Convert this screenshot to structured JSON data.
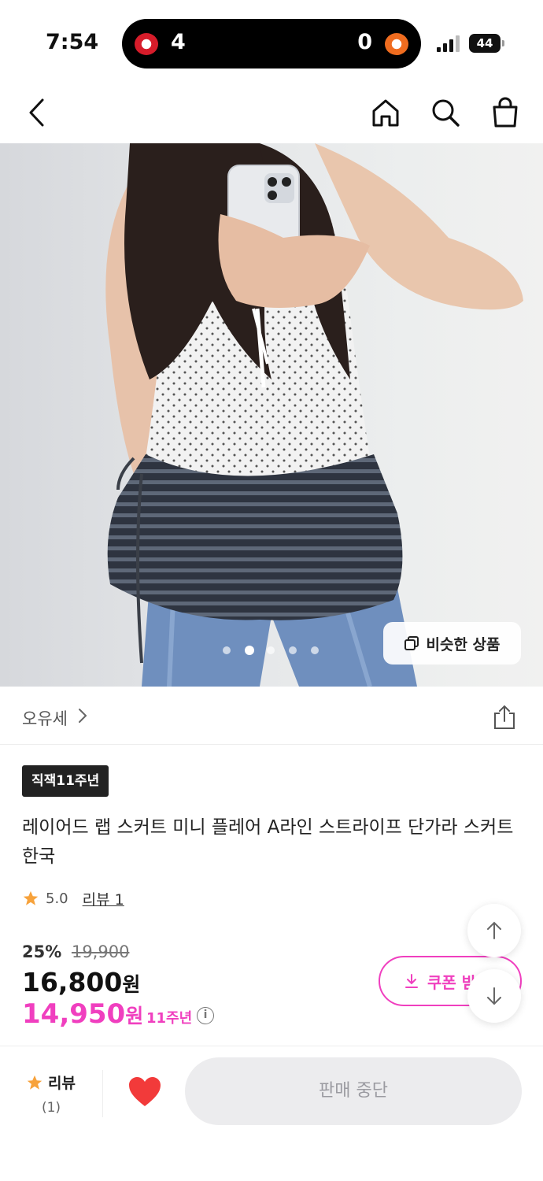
{
  "status_bar": {
    "time": "7:54",
    "score_left": "4",
    "score_right": "0",
    "battery": "44"
  },
  "nav": {
    "back_icon": "chevron-left-icon",
    "home_icon": "home-icon",
    "search_icon": "search-icon",
    "cart_icon": "shopping-bag-icon"
  },
  "hero": {
    "image_dots_count": 5,
    "active_dot": 2,
    "similar_button_label": "비슷한 상품"
  },
  "shop": {
    "name": "오유세",
    "share_icon": "share-icon"
  },
  "product": {
    "badge": "직잭11주년",
    "title": "레이어드 랩 스커트 미니 플레어 A라인 스트라이프 단가라 스커트 한국",
    "rating": "5.0",
    "review_link": "리뷰 1",
    "discount_percent": "25%",
    "original_price": "19,900",
    "price": "16,800",
    "price_unit": "원",
    "sale_price": "14,950",
    "sale_unit": "원",
    "sale_tag": "11주년",
    "coupon_label": "쿠폰 받"
  },
  "bottom_bar": {
    "review_label": "리뷰",
    "review_count": "(1)",
    "soldout_label": "판매 중단"
  },
  "colors": {
    "accent": "#f03fbf",
    "star": "#f7a23b",
    "heart": "#f23a3a"
  }
}
